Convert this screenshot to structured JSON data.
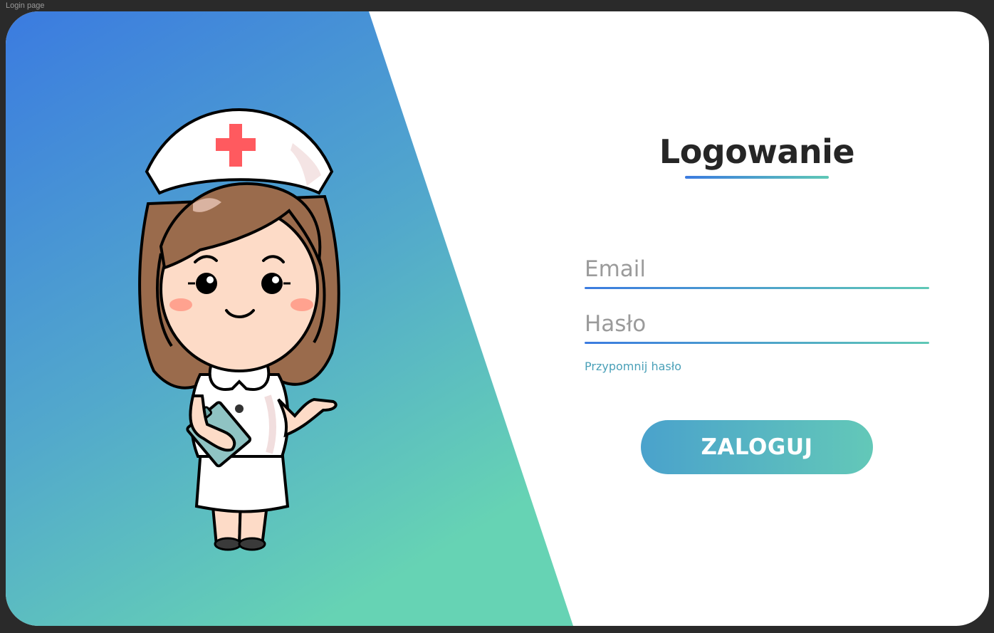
{
  "frame": {
    "label": "Login page"
  },
  "login": {
    "title": "Logowanie",
    "email_placeholder": "Email",
    "password_placeholder": "Hasło",
    "forgot_password": "Przypomnij hasło",
    "submit_label": "ZALOGUJ"
  },
  "colors": {
    "gradient_start": "#3b7be0",
    "gradient_end": "#63d2b4",
    "title_text": "#262626",
    "link_text": "#4aa0b8",
    "nurse_cross": "#ff5a5f"
  },
  "illustration": {
    "icon": "nurse-illustration"
  }
}
